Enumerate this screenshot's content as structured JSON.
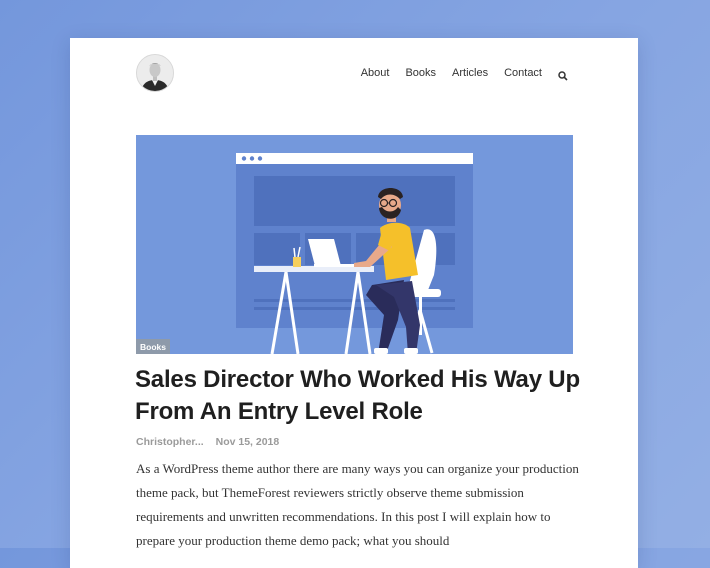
{
  "nav": {
    "items": [
      "About",
      "Books",
      "Articles",
      "Contact"
    ],
    "search_icon": "search-icon"
  },
  "post": {
    "category": "Books",
    "title": "Sales Director Who Worked His Way Up From An Entry Level Role",
    "author": "Christopher...",
    "date": "Nov 15, 2018",
    "excerpt": "As a WordPress theme author there are many ways you can organize your production theme pack, but ThemeForest reviewers strictly observe theme submission requirements and unwritten recommendations. In this post I will explain how to prepare your production theme demo pack; what you should"
  },
  "colors": {
    "page_background": "#7b9cdd",
    "hero_background": "#7498dc",
    "shirt": "#f5c02a",
    "title_text": "#1f1f1f",
    "meta_text": "#9a9a9a"
  }
}
